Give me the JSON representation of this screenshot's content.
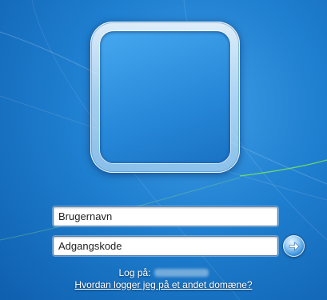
{
  "login": {
    "username_placeholder": "Brugernavn",
    "password_placeholder": "Adgangskode",
    "logon_to_label": "Log på:",
    "domain_help_link": "Hvordan logger jeg på et andet domæne?"
  },
  "icons": {
    "avatar": "user-avatar-frame",
    "submit": "arrow-right-icon"
  },
  "colors": {
    "background": "#1f7fd0",
    "accent": "#2f88d6"
  }
}
